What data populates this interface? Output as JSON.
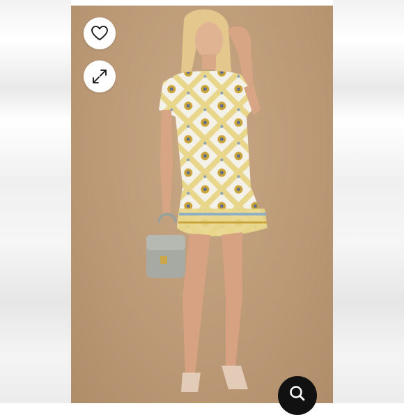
{
  "icons": {
    "like": "heart-icon",
    "expand": "expand-icon",
    "search": "search-icon"
  },
  "colors": {
    "photo_background": "#bc9a77",
    "button_background": "#ffffff",
    "fab_background": "#111111",
    "dress_base": "#e9d98f",
    "dress_tile": "#f3f1ea"
  }
}
